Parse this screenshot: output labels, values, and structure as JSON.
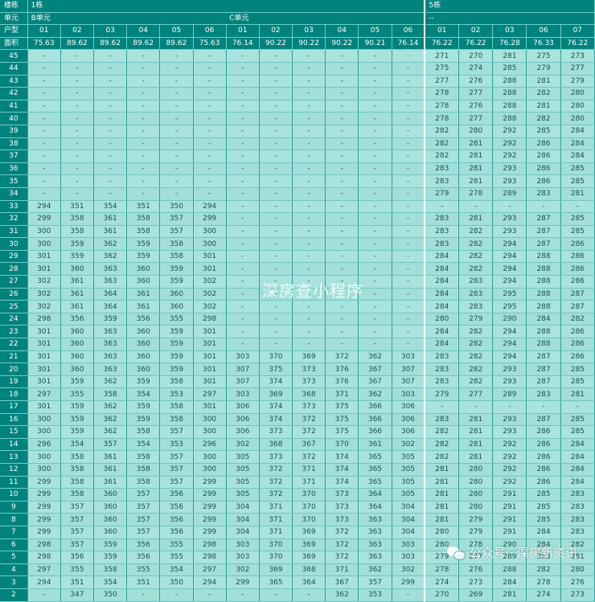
{
  "header": {
    "row_labels": {
      "building": "楼栋",
      "unit": "单元",
      "type": "户型",
      "area": "面积"
    },
    "buildings": [
      {
        "name": "1栋"
      },
      {
        "name": "5栋"
      }
    ],
    "units": [
      {
        "name": "B单元"
      },
      {
        "name": "C单元"
      },
      {
        "name": "--"
      }
    ],
    "unit_types": [
      "01",
      "02",
      "03",
      "04",
      "05",
      "06",
      "01",
      "02",
      "03",
      "04",
      "05",
      "06",
      "01",
      "02",
      "03",
      "06",
      "07"
    ],
    "areas": [
      "75.63",
      "89.62",
      "89.62",
      "89.62",
      "89.62",
      "75.63",
      "76.14",
      "90.22",
      "90.22",
      "90.22",
      "90.21",
      "76.14",
      "76.22",
      "76.22",
      "76.28",
      "76.33",
      "76.22"
    ]
  },
  "rows": [
    {
      "floor": "45",
      "values": [
        "-",
        "-",
        "-",
        "-",
        "-",
        "-",
        "-",
        "-",
        "-",
        "-",
        "-",
        "-",
        "271",
        "270",
        "281",
        "275",
        "273"
      ]
    },
    {
      "floor": "44",
      "values": [
        "-",
        "-",
        "-",
        "-",
        "-",
        "-",
        "-",
        "-",
        "-",
        "-",
        "-",
        "-",
        "275",
        "274",
        "285",
        "279",
        "277"
      ]
    },
    {
      "floor": "43",
      "values": [
        "-",
        "-",
        "-",
        "-",
        "-",
        "-",
        "-",
        "-",
        "-",
        "-",
        "-",
        "-",
        "277",
        "276",
        "288",
        "281",
        "279"
      ]
    },
    {
      "floor": "42",
      "values": [
        "-",
        "-",
        "-",
        "-",
        "-",
        "-",
        "-",
        "-",
        "-",
        "-",
        "-",
        "-",
        "278",
        "277",
        "288",
        "282",
        "280"
      ]
    },
    {
      "floor": "41",
      "values": [
        "-",
        "-",
        "-",
        "-",
        "-",
        "-",
        "-",
        "-",
        "-",
        "-",
        "-",
        "-",
        "278",
        "276",
        "288",
        "281",
        "280"
      ]
    },
    {
      "floor": "40",
      "values": [
        "-",
        "-",
        "-",
        "-",
        "-",
        "-",
        "-",
        "-",
        "-",
        "-",
        "-",
        "-",
        "278",
        "277",
        "288",
        "282",
        "280"
      ]
    },
    {
      "floor": "39",
      "values": [
        "-",
        "-",
        "-",
        "-",
        "-",
        "-",
        "-",
        "-",
        "-",
        "-",
        "-",
        "-",
        "282",
        "280",
        "292",
        "285",
        "284"
      ]
    },
    {
      "floor": "38",
      "values": [
        "-",
        "-",
        "-",
        "-",
        "-",
        "-",
        "-",
        "-",
        "-",
        "-",
        "-",
        "-",
        "282",
        "281",
        "292",
        "286",
        "284"
      ]
    },
    {
      "floor": "37",
      "values": [
        "-",
        "-",
        "-",
        "-",
        "-",
        "-",
        "-",
        "-",
        "-",
        "-",
        "-",
        "-",
        "282",
        "281",
        "292",
        "286",
        "284"
      ]
    },
    {
      "floor": "36",
      "values": [
        "-",
        "-",
        "-",
        "-",
        "-",
        "-",
        "-",
        "-",
        "-",
        "-",
        "-",
        "-",
        "283",
        "281",
        "293",
        "286",
        "285"
      ]
    },
    {
      "floor": "35",
      "values": [
        "-",
        "-",
        "-",
        "-",
        "-",
        "-",
        "-",
        "-",
        "-",
        "-",
        "-",
        "-",
        "283",
        "281",
        "293",
        "286",
        "285"
      ]
    },
    {
      "floor": "34",
      "values": [
        "-",
        "-",
        "-",
        "-",
        "-",
        "-",
        "-",
        "-",
        "-",
        "-",
        "-",
        "-",
        "279",
        "278",
        "289",
        "283",
        "281"
      ]
    },
    {
      "floor": "33",
      "values": [
        "294",
        "351",
        "354",
        "351",
        "350",
        "294",
        "-",
        "-",
        "-",
        "-",
        "-",
        "-",
        "-",
        "-",
        "-",
        "-",
        "-"
      ]
    },
    {
      "floor": "32",
      "values": [
        "299",
        "358",
        "361",
        "358",
        "357",
        "299",
        "-",
        "-",
        "-",
        "-",
        "-",
        "-",
        "283",
        "281",
        "293",
        "287",
        "285"
      ]
    },
    {
      "floor": "31",
      "values": [
        "300",
        "358",
        "361",
        "358",
        "357",
        "300",
        "-",
        "-",
        "-",
        "-",
        "-",
        "-",
        "283",
        "282",
        "293",
        "287",
        "285"
      ]
    },
    {
      "floor": "30",
      "values": [
        "300",
        "359",
        "362",
        "359",
        "358",
        "300",
        "-",
        "-",
        "-",
        "-",
        "-",
        "-",
        "283",
        "282",
        "294",
        "287",
        "286"
      ]
    },
    {
      "floor": "29",
      "values": [
        "301",
        "359",
        "362",
        "359",
        "358",
        "301",
        "-",
        "-",
        "-",
        "-",
        "-",
        "-",
        "284",
        "282",
        "294",
        "288",
        "286"
      ]
    },
    {
      "floor": "28",
      "values": [
        "301",
        "360",
        "363",
        "360",
        "359",
        "301",
        "-",
        "-",
        "-",
        "-",
        "-",
        "-",
        "284",
        "282",
        "294",
        "288",
        "286"
      ]
    },
    {
      "floor": "27",
      "values": [
        "302",
        "361",
        "363",
        "360",
        "359",
        "302",
        "-",
        "-",
        "-",
        "-",
        "-",
        "-",
        "284",
        "283",
        "294",
        "288",
        "286"
      ]
    },
    {
      "floor": "26",
      "values": [
        "302",
        "361",
        "364",
        "361",
        "360",
        "302",
        "-",
        "-",
        "-",
        "-",
        "-",
        "-",
        "284",
        "283",
        "295",
        "288",
        "287"
      ]
    },
    {
      "floor": "25",
      "values": [
        "302",
        "361",
        "364",
        "361",
        "360",
        "302",
        "-",
        "-",
        "-",
        "-",
        "-",
        "-",
        "284",
        "283",
        "295",
        "288",
        "287"
      ]
    },
    {
      "floor": "24",
      "values": [
        "298",
        "356",
        "359",
        "356",
        "355",
        "298",
        "-",
        "-",
        "-",
        "-",
        "-",
        "-",
        "280",
        "279",
        "290",
        "284",
        "282"
      ]
    },
    {
      "floor": "23",
      "values": [
        "301",
        "360",
        "363",
        "360",
        "359",
        "301",
        "-",
        "-",
        "-",
        "-",
        "-",
        "-",
        "284",
        "282",
        "294",
        "288",
        "286"
      ]
    },
    {
      "floor": "22",
      "values": [
        "301",
        "360",
        "363",
        "360",
        "359",
        "301",
        "-",
        "-",
        "-",
        "-",
        "-",
        "-",
        "284",
        "282",
        "294",
        "288",
        "286"
      ]
    },
    {
      "floor": "21",
      "values": [
        "301",
        "360",
        "363",
        "360",
        "359",
        "301",
        "303",
        "370",
        "369",
        "372",
        "362",
        "303",
        "283",
        "282",
        "294",
        "287",
        "286"
      ]
    },
    {
      "floor": "20",
      "values": [
        "301",
        "360",
        "363",
        "360",
        "359",
        "301",
        "307",
        "375",
        "373",
        "376",
        "367",
        "307",
        "283",
        "282",
        "293",
        "287",
        "285"
      ]
    },
    {
      "floor": "19",
      "values": [
        "301",
        "359",
        "362",
        "359",
        "358",
        "301",
        "307",
        "374",
        "373",
        "376",
        "367",
        "307",
        "283",
        "282",
        "293",
        "287",
        "285"
      ]
    },
    {
      "floor": "18",
      "values": [
        "297",
        "355",
        "358",
        "354",
        "353",
        "297",
        "303",
        "369",
        "368",
        "371",
        "362",
        "303",
        "279",
        "277",
        "289",
        "283",
        "281"
      ]
    },
    {
      "floor": "17",
      "values": [
        "301",
        "359",
        "362",
        "359",
        "358",
        "301",
        "306",
        "374",
        "373",
        "375",
        "366",
        "306",
        "-",
        "-",
        "-",
        "-",
        "-"
      ]
    },
    {
      "floor": "16",
      "values": [
        "300",
        "359",
        "362",
        "359",
        "358",
        "300",
        "306",
        "374",
        "372",
        "375",
        "366",
        "306",
        "283",
        "281",
        "293",
        "287",
        "285"
      ]
    },
    {
      "floor": "15",
      "values": [
        "300",
        "359",
        "362",
        "358",
        "357",
        "300",
        "306",
        "373",
        "372",
        "375",
        "366",
        "306",
        "282",
        "281",
        "293",
        "286",
        "285"
      ]
    },
    {
      "floor": "14",
      "values": [
        "296",
        "354",
        "357",
        "354",
        "353",
        "296",
        "302",
        "368",
        "367",
        "370",
        "361",
        "302",
        "282",
        "281",
        "292",
        "286",
        "284"
      ]
    },
    {
      "floor": "13",
      "values": [
        "300",
        "358",
        "361",
        "358",
        "357",
        "300",
        "305",
        "373",
        "372",
        "374",
        "365",
        "305",
        "282",
        "281",
        "292",
        "286",
        "284"
      ]
    },
    {
      "floor": "12",
      "values": [
        "300",
        "358",
        "361",
        "358",
        "357",
        "300",
        "305",
        "372",
        "371",
        "374",
        "365",
        "305",
        "281",
        "280",
        "292",
        "286",
        "284"
      ]
    },
    {
      "floor": "11",
      "values": [
        "299",
        "358",
        "361",
        "358",
        "357",
        "299",
        "305",
        "372",
        "371",
        "374",
        "365",
        "305",
        "281",
        "280",
        "292",
        "286",
        "284"
      ]
    },
    {
      "floor": "10",
      "values": [
        "299",
        "358",
        "360",
        "357",
        "356",
        "299",
        "305",
        "372",
        "370",
        "373",
        "364",
        "305",
        "281",
        "280",
        "291",
        "285",
        "283"
      ]
    },
    {
      "floor": "9",
      "values": [
        "299",
        "357",
        "360",
        "357",
        "356",
        "299",
        "304",
        "371",
        "370",
        "373",
        "364",
        "304",
        "281",
        "280",
        "291",
        "285",
        "283"
      ]
    },
    {
      "floor": "8",
      "values": [
        "299",
        "357",
        "360",
        "357",
        "356",
        "299",
        "304",
        "371",
        "370",
        "373",
        "363",
        "304",
        "281",
        "279",
        "291",
        "285",
        "283"
      ]
    },
    {
      "floor": "7",
      "values": [
        "299",
        "357",
        "360",
        "357",
        "356",
        "299",
        "304",
        "371",
        "369",
        "372",
        "363",
        "304",
        "280",
        "279",
        "291",
        "284",
        "283"
      ]
    },
    {
      "floor": "6",
      "values": [
        "298",
        "357",
        "359",
        "356",
        "355",
        "298",
        "303",
        "370",
        "369",
        "372",
        "363",
        "303",
        "280",
        "278",
        "290",
        "284",
        "282"
      ]
    },
    {
      "floor": "5",
      "values": [
        "298",
        "356",
        "359",
        "356",
        "355",
        "298",
        "303",
        "370",
        "369",
        "372",
        "363",
        "303",
        "279",
        "277",
        "289",
        "283",
        "281"
      ]
    },
    {
      "floor": "4",
      "values": [
        "297",
        "355",
        "358",
        "355",
        "354",
        "297",
        "302",
        "369",
        "368",
        "371",
        "362",
        "302",
        "278",
        "276",
        "288",
        "282",
        "280"
      ]
    },
    {
      "floor": "3",
      "values": [
        "294",
        "351",
        "354",
        "351",
        "350",
        "294",
        "299",
        "365",
        "364",
        "367",
        "357",
        "299",
        "274",
        "273",
        "284",
        "278",
        "276"
      ]
    },
    {
      "floor": "2",
      "values": [
        "-",
        "347",
        "350",
        "-",
        "-",
        "-",
        "-",
        "-",
        "-",
        "362",
        "353",
        "-",
        "270",
        "269",
        "281",
        "274",
        "273"
      ]
    }
  ],
  "watermark": "深房查小程序",
  "footer": {
    "account": "公众号 · 深房新资讯"
  },
  "icons": {
    "footer": "wechat-icon"
  },
  "colors": {
    "header_bg": "#00827d",
    "cell_bg": "#a6e2dc",
    "text": "#1d4f4c"
  }
}
